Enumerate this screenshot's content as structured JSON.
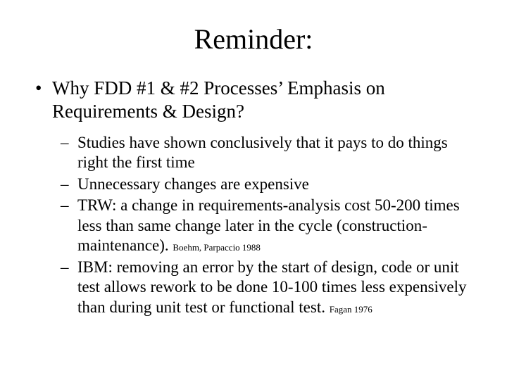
{
  "title": "Reminder:",
  "bullet": "Why FDD #1 & #2 Processes’ Emphasis on Requirements & Design?",
  "subs": [
    {
      "text": "Studies have shown conclusively that it pays to do things right the first time",
      "cite": ""
    },
    {
      "text": "Unnecessary changes are expensive",
      "cite": ""
    },
    {
      "text": "TRW: a change in requirements-analysis cost 50-200 times less than same change later in the cycle (construction-maintenance).",
      "cite": "Boehm, Parpaccio 1988"
    },
    {
      "text": "IBM: removing an error by the start of design, code or unit test allows rework to be done 10-100 times less expensively than during unit test or functional test.",
      "cite": "Fagan 1976"
    }
  ]
}
